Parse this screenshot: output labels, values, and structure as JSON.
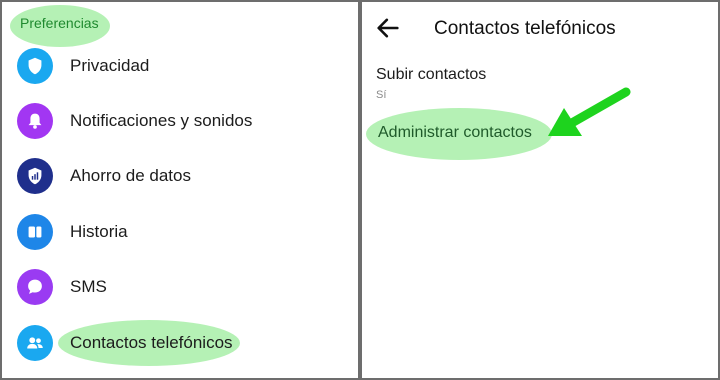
{
  "left_panel": {
    "section_title": "Preferencias",
    "items": [
      {
        "label": "Privacidad",
        "icon": "shield-icon",
        "color": "#1aa8f0"
      },
      {
        "label": "Notificaciones y sonidos",
        "icon": "bell-icon",
        "color": "#a236f2"
      },
      {
        "label": "Ahorro de datos",
        "icon": "data-shield-icon",
        "color": "#1f2f8c"
      },
      {
        "label": "Historia",
        "icon": "stories-icon",
        "color": "#1e86e8"
      },
      {
        "label": "SMS",
        "icon": "chat-bubble-icon",
        "color": "#9a3bf2"
      },
      {
        "label": "Contactos telefónicos",
        "icon": "contacts-icon",
        "color": "#1aa8f0",
        "highlighted": true
      }
    ]
  },
  "right_panel": {
    "title": "Contactos telefónicos",
    "upload_contacts": {
      "label": "Subir contactos",
      "value": "Sí"
    },
    "manage_contacts": {
      "label": "Administrar contactos",
      "highlighted": true
    }
  },
  "annotation": {
    "highlight_color": "#7ee67e",
    "arrow_color": "#1ed31e"
  }
}
